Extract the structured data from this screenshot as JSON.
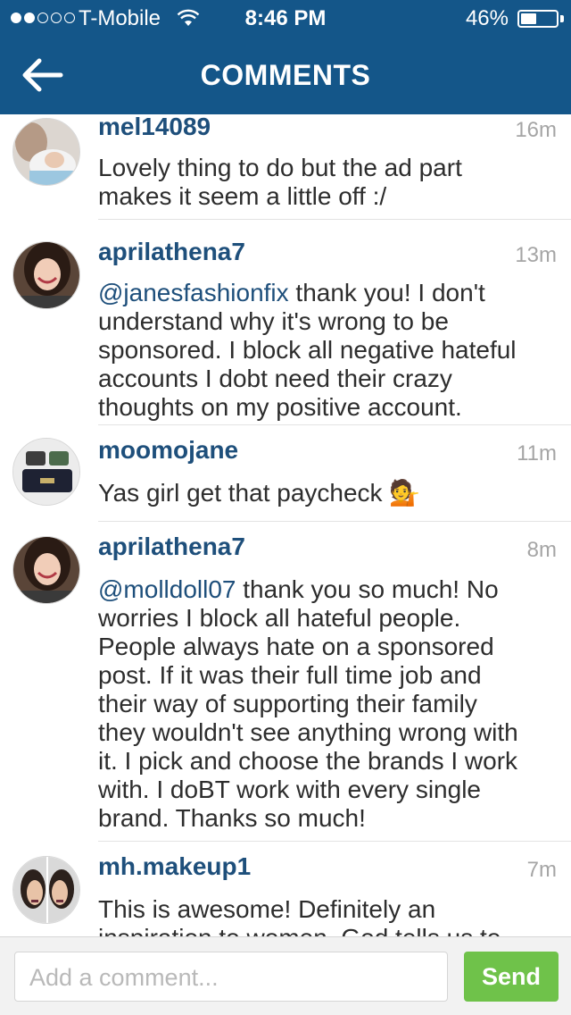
{
  "status_bar": {
    "carrier": "T-Mobile",
    "time": "8:46 PM",
    "battery_percent": "46%",
    "battery_level": 0.46,
    "signal_bars": 2,
    "signal_total": 5
  },
  "header": {
    "title": "COMMENTS",
    "back_icon": "arrow-left-icon",
    "background": "#145689"
  },
  "comments": [
    {
      "username": "mel14089",
      "timestamp": "16m",
      "mention": "",
      "text": "Lovely thing to do but the ad part\nmakes it seem a little off :/"
    },
    {
      "username": "aprilathena7",
      "timestamp": "13m",
      "mention": "@janesfashionfix",
      "text": " thank you!  I don't\nunderstand why it's wrong to be\nsponsored.  I block all negative hateful\naccounts I dobt need their crazy\nthoughts on my positive account."
    },
    {
      "username": "moomojane",
      "timestamp": "11m",
      "mention": "",
      "text": "Yas girl get that paycheck 💁"
    },
    {
      "username": "aprilathena7",
      "timestamp": "8m",
      "mention": "@molldoll07",
      "text": " thank you so much!  No\nworries I block all hateful people.\nPeople always hate on a sponsored\npost.  If it was their full time job and\ntheir way of supporting their family\nthey wouldn't see anything  wrong with\nit.  I pick and choose the brands I work\nwith.  I doBT work with every single\nbrand.  Thanks so much!"
    },
    {
      "username": "mh.makeup1",
      "timestamp": "7m",
      "mention": "",
      "text": "This is awesome! Definitely an\ninspiration to women. God tells us to"
    }
  ],
  "composer": {
    "placeholder": "Add a comment...",
    "send_label": "Send",
    "send_color": "#6fc24a"
  }
}
